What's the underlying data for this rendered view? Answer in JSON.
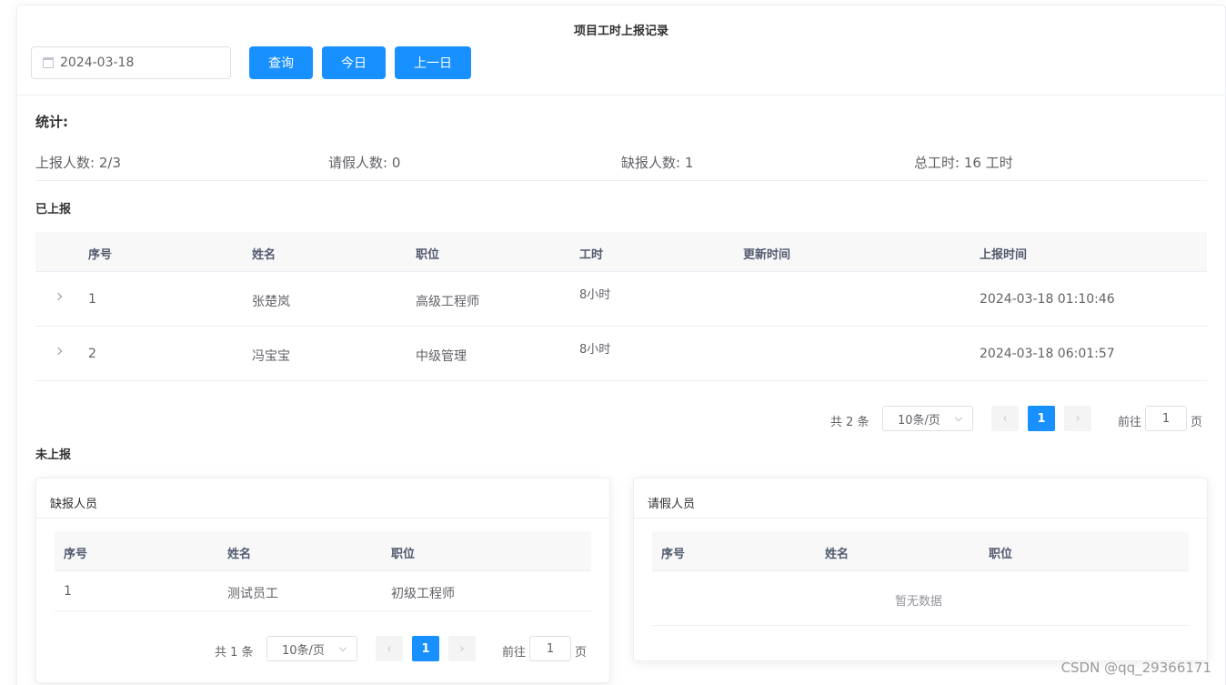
{
  "page": {
    "title": "项目工时上报记录"
  },
  "toolbar": {
    "date_value": "2024-03-18",
    "query_label": "查询",
    "today_label": "今日",
    "prev_day_label": "上一日"
  },
  "stats": {
    "title": "统计:",
    "reported_label": "上报人数:",
    "reported_value": "2/3",
    "leave_label": "请假人数:",
    "leave_value": "0",
    "missing_label": "缺报人数:",
    "missing_value": "1",
    "total_label": "总工时:",
    "total_value": "16 工时"
  },
  "reported": {
    "section_label": "已上报",
    "columns": [
      "序号",
      "姓名",
      "职位",
      "工时",
      "更新时间",
      "上报时间"
    ],
    "rows": [
      {
        "index": "1",
        "name": "张楚岚",
        "position": "高级工程师",
        "hours": "8小时",
        "updated": "",
        "reported_at": "2024-03-18 01:10:46"
      },
      {
        "index": "2",
        "name": "冯宝宝",
        "position": "中级管理",
        "hours": "8小时",
        "updated": "",
        "reported_at": "2024-03-18 06:01:57"
      }
    ],
    "pager": {
      "total": "共 2 条",
      "page_size": "10条/页",
      "current": "1",
      "goto_label": "前往",
      "goto_value": "1",
      "page_unit": "页"
    }
  },
  "unreported": {
    "section_label": "未上报",
    "missing": {
      "title": "缺报人员",
      "columns": [
        "序号",
        "姓名",
        "职位"
      ],
      "rows": [
        {
          "index": "1",
          "name": "测试员工",
          "position": "初级工程师"
        }
      ],
      "pager": {
        "total": "共 1 条",
        "page_size": "10条/页",
        "current": "1",
        "goto_label": "前往",
        "goto_value": "1",
        "page_unit": "页"
      }
    },
    "leave": {
      "title": "请假人员",
      "columns": [
        "序号",
        "姓名",
        "职位"
      ],
      "empty_text": "暂无数据"
    }
  },
  "watermark": "CSDN @qq_29366171",
  "colors": {
    "primary": "#1890ff",
    "header_bg": "#f8f8f9",
    "border": "#ebeef5"
  },
  "icons": [
    "calendar-icon",
    "chevron-right-icon",
    "chevron-left-icon",
    "caret-down-icon"
  ]
}
